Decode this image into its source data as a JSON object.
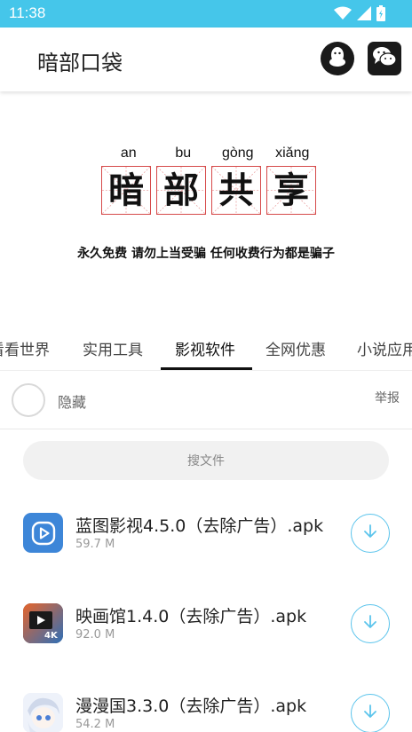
{
  "status_bar": {
    "time": "11:38"
  },
  "app_bar": {
    "title": "暗部口袋",
    "qq_icon": "qq-penguin-icon",
    "wechat_icon": "wechat-icon"
  },
  "banner": {
    "pinyin": [
      "an",
      "bu",
      "gòng",
      "xiǎng"
    ],
    "chars": [
      "暗",
      "部",
      "共",
      "享"
    ],
    "slogan": "永久免费 请勿上当受骗 任何收费行为都是骗子"
  },
  "tabs": [
    {
      "label": "看看世界",
      "active": false
    },
    {
      "label": "实用工具",
      "active": false
    },
    {
      "label": "影视软件",
      "active": true
    },
    {
      "label": "全网优惠",
      "active": false
    },
    {
      "label": "小说应用",
      "active": false
    }
  ],
  "post": {
    "hide_label": "隐藏",
    "report_label": "举报"
  },
  "search": {
    "placeholder": "搜文件"
  },
  "files": [
    {
      "name": "蓝图影视4.5.0（去除广告）.apk",
      "size": "59.7 M"
    },
    {
      "name": "映画馆1.4.0（去除广告）.apk",
      "size": "92.0 M"
    },
    {
      "name": "漫漫国3.3.0（去除广告）.apk",
      "size": "54.2 M"
    }
  ],
  "colors": {
    "status_bar": "#45c6ea",
    "accent": "#5bc4ec",
    "grid_red": "#d64a4a"
  }
}
